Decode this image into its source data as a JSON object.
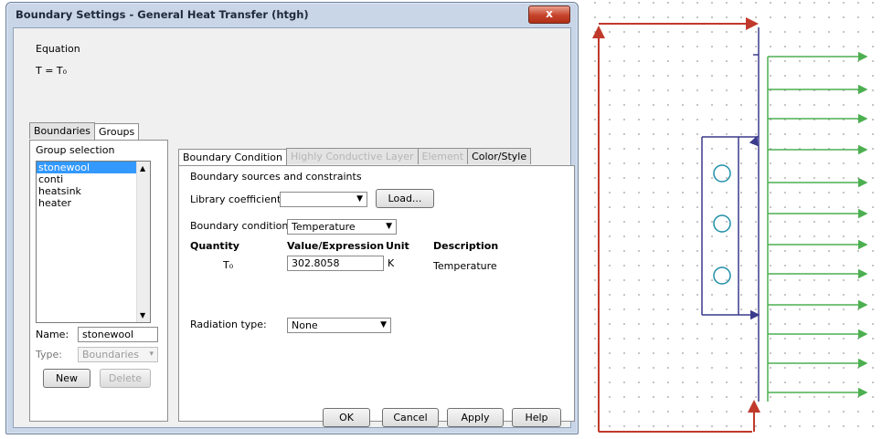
{
  "dialog": {
    "title": "Boundary Settings - General Heat Transfer (htgh)",
    "close_label": "x",
    "equation_label": "Equation",
    "equation": "T = T₀"
  },
  "left_tabs": [
    "Boundaries",
    "Groups"
  ],
  "group_panel": {
    "heading": "Group selection",
    "items": [
      "stonewool",
      "conti",
      "heatsink",
      "heater"
    ],
    "selected_index": 0,
    "name_label": "Name:",
    "name_value": "stonewool",
    "type_label": "Type:",
    "type_value": "Boundaries",
    "new_label": "New",
    "delete_label": "Delete"
  },
  "right_tabs": [
    "Boundary Condition",
    "Highly Conductive Layer",
    "Element",
    "Color/Style"
  ],
  "boundary_panel": {
    "heading": "Boundary sources and constraints",
    "library_label": "Library coefficient:",
    "load_label": "Load...",
    "bc_label": "Boundary condition:",
    "bc_value": "Temperature",
    "col_quantity": "Quantity",
    "col_value": "Value/Expression",
    "col_unit": "Unit",
    "col_description": "Description",
    "row_quantity": "T₀",
    "row_value": "302.8058",
    "row_unit": "K",
    "row_description": "Temperature",
    "radiation_label": "Radiation type:",
    "radiation_value": "None"
  },
  "footer": {
    "ok": "OK",
    "cancel": "Cancel",
    "apply": "Apply",
    "help": "Help"
  },
  "colors": {
    "outer_boundary": "#c0392b",
    "inner_boundary": "#3b3a8c",
    "heatsink_fins": "#4caf50",
    "heater_circles": "#1f8fa8",
    "grid_dots": "#9a9a9a"
  }
}
